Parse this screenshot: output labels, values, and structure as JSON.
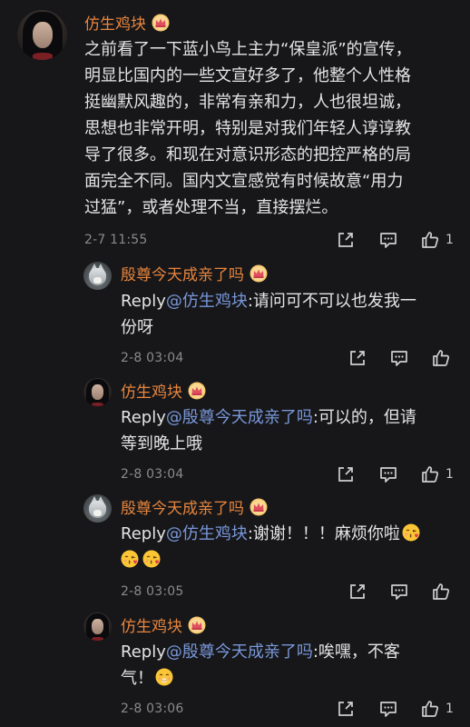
{
  "colors": {
    "background": "#17171a",
    "username": "#e7853d",
    "mention": "#7897d8",
    "text": "#e4e4e4",
    "meta": "#8a8a8c"
  },
  "comments": [
    {
      "username": "仿生鸡块",
      "text_lines": [
        "之前看了一下蓝小鸟上主力“保皇派”的宣传，",
        "明显比国内的一些文宣好多了，他整个人性格",
        "挺幽默风趣的，非常有亲和力，人也很坦诚，",
        "思想也非常开明，特别是对我们年轻人谆谆教",
        "导了很多。和现在对意识形态的把控严格的局",
        "面完全不同。国内文宣感觉有时候故意“用力",
        "过猛”，或者处理不当，直接摆烂。"
      ],
      "timestamp": "2-7 11:55",
      "like_count": "1"
    },
    {
      "username": "殷尊今天成亲了吗",
      "reply_prefix": "Reply",
      "mention": "@仿生鸡块",
      "text_line1": ":请问可不可以也发我一",
      "text_line2": "份呀",
      "timestamp": "2-8 03:04",
      "like_count": ""
    },
    {
      "username": "仿生鸡块",
      "reply_prefix": "Reply",
      "mention": "@殷尊今天成亲了吗",
      "text_line1": ":可以的，但请",
      "text_line2": "等到晚上哦",
      "timestamp": "2-8 03:04",
      "like_count": "1"
    },
    {
      "username": "殷尊今天成亲了吗",
      "reply_prefix": "Reply",
      "mention": "@仿生鸡块",
      "text_line1": ":谢谢！！！麻烦你啦",
      "text_line2": "",
      "emojis": [
        "kiss-face-emoji",
        "kiss-face-emoji",
        "kiss-face-emoji"
      ],
      "timestamp": "2-8 03:05",
      "like_count": ""
    },
    {
      "username": "仿生鸡块",
      "reply_prefix": "Reply",
      "mention": "@殷尊今天成亲了吗",
      "text_line1": ":唉嘿，不客",
      "text_line2": "气！",
      "emojis": [
        "giggle-face-emoji"
      ],
      "timestamp": "2-8 03:06",
      "like_count": "1"
    }
  ]
}
